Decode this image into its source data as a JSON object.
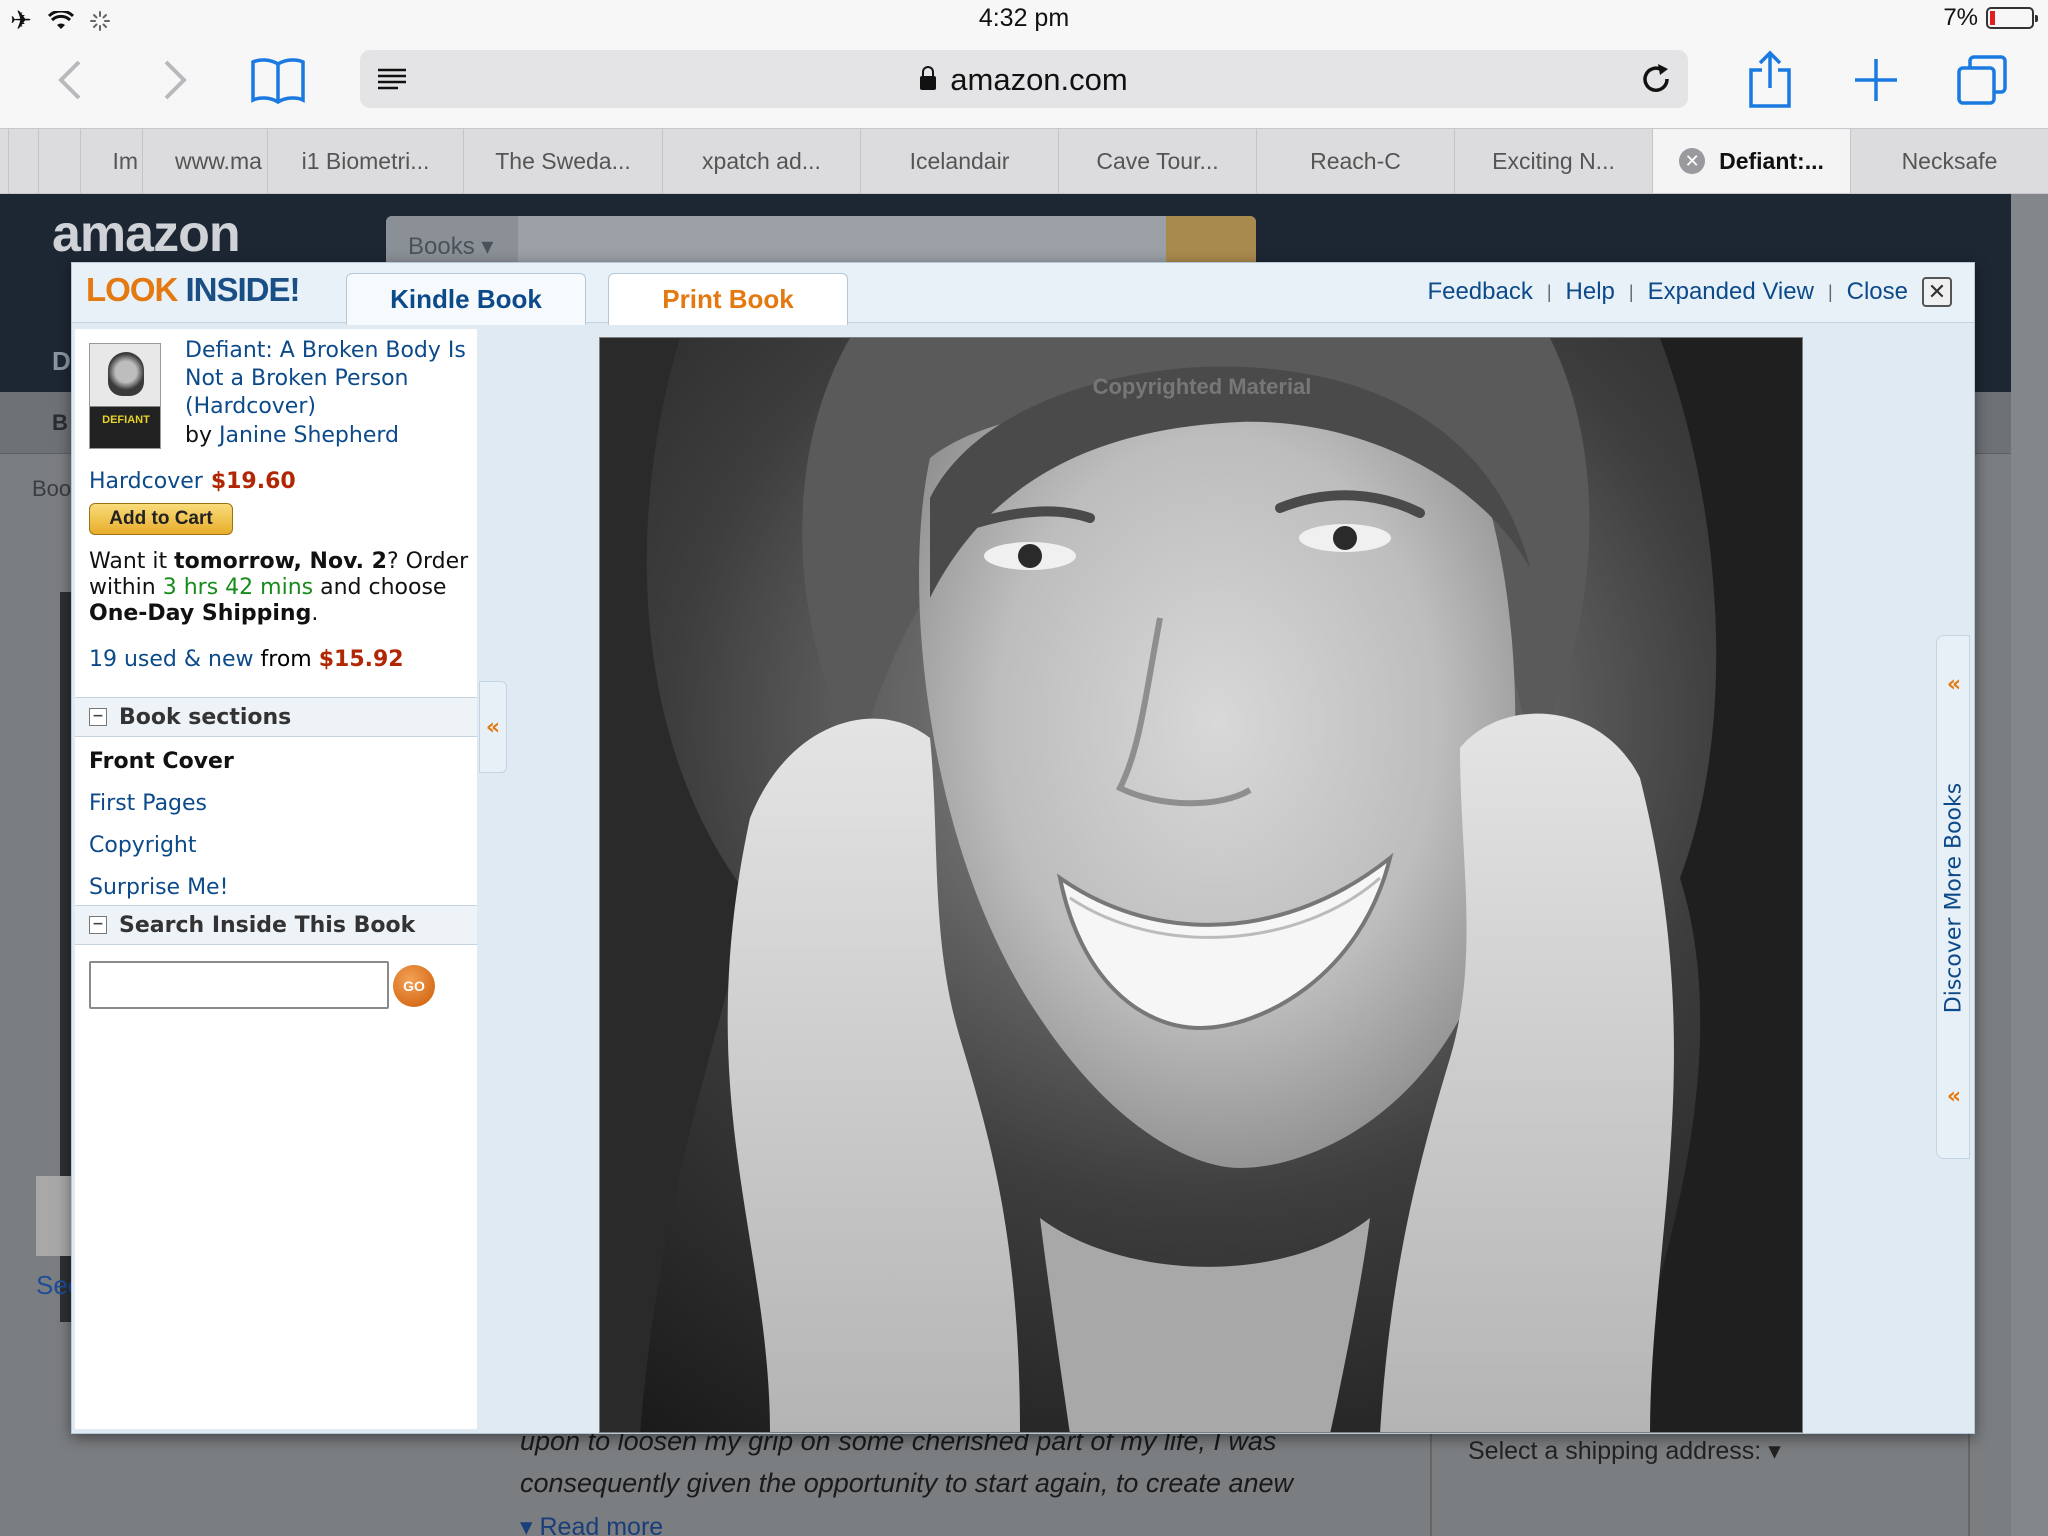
{
  "status": {
    "time": "4:32 pm",
    "battery": "7%"
  },
  "browser": {
    "url": "amazon.com",
    "tabs": [
      {
        "label": "Im",
        "active": false
      },
      {
        "label": "www.ma",
        "active": false
      },
      {
        "label": "i1 Biometri...",
        "active": false
      },
      {
        "label": "The Sweda...",
        "active": false
      },
      {
        "label": "xpatch ad...",
        "active": false
      },
      {
        "label": "Icelandair",
        "active": false
      },
      {
        "label": "Cave Tour...",
        "active": false
      },
      {
        "label": "Reach-C",
        "active": false
      },
      {
        "label": "Exciting N...",
        "active": false
      },
      {
        "label": "Defiant:...",
        "active": true
      },
      {
        "label": "Necksafe",
        "active": false
      }
    ],
    "icons": [
      "airplane-icon",
      "wifi-icon",
      "activity-spinner-icon",
      "back-icon",
      "forward-icon",
      "bookmarks-icon",
      "reader-icon",
      "lock-icon",
      "reload-icon",
      "share-icon",
      "new-tab-icon",
      "tabs-icon"
    ]
  },
  "background_page": {
    "logo": "amazon",
    "search_department": "Books",
    "nav_left_fragment": "D",
    "nav2_left_fragment": "B",
    "breadcrumb_fragment": "Boo",
    "see_fragment": "See",
    "description_line1": "upon to loosen my grip on some cherished part of my life, I was",
    "description_line2": "consequently given the opportunity to start again, to create anew",
    "read_more": "Read more",
    "shipping_label": "Select a shipping address:"
  },
  "look_inside": {
    "logo_part1": "LOOK",
    "logo_part2": "INSIDE!",
    "tabs": {
      "kindle": "Kindle Book",
      "print": "Print Book"
    },
    "links": {
      "feedback": "Feedback",
      "help": "Help",
      "expanded": "Expanded View",
      "close": "Close"
    },
    "book": {
      "title": "Defiant: A Broken Body Is Not a Broken Person (Hardcover)",
      "by_prefix": "by",
      "author": "Janine Shepherd",
      "cover_word": "DEFIANT",
      "format": "Hardcover",
      "price": "$19.60",
      "add_to_cart": "Add to Cart",
      "delivery_1": "Want it ",
      "delivery_2": "tomorrow, Nov. 2",
      "delivery_3": "? Order within ",
      "delivery_4": "3 hrs 42 mins",
      "delivery_5": " and choose ",
      "delivery_6": "One-Day Shipping",
      "delivery_7": ".",
      "used_link": "19 used & new",
      "used_from": " from ",
      "used_price": "$15.92"
    },
    "sections": {
      "header": "Book sections",
      "items": [
        "Front Cover",
        "First Pages",
        "Copyright",
        "Surprise Me!"
      ],
      "active_index": 0
    },
    "search": {
      "header": "Search Inside This Book",
      "value": "",
      "go": "GO"
    },
    "viewer": {
      "watermark": "Copyrighted Material"
    },
    "discover": "Discover More Books"
  }
}
